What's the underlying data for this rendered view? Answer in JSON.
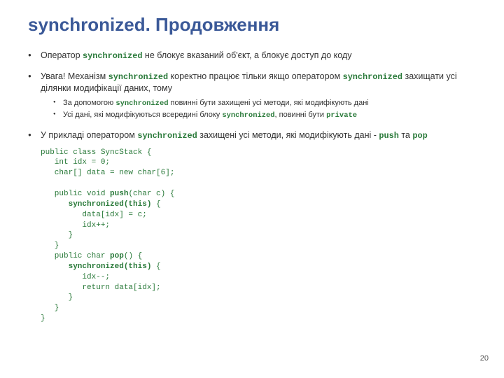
{
  "title": "synchronized. Продовження",
  "bullet1": {
    "pre": "Оператор ",
    "kw": "synchronized",
    "post": " не блокує вказаний об'єкт, а блокує доступ до коду"
  },
  "bullet2": {
    "pre": "Увага! Механізм ",
    "kw1": "synchronized",
    "mid": " коректно працює тільки якщо оператором ",
    "kw2": "synchronized",
    "post": " захищати усі ділянки модифікації даних, тому"
  },
  "bullet2_sub1": {
    "pre": "За допомогою ",
    "kw": "synchronized",
    "post": " повинні бути захищені усі методи, які модифікують дані"
  },
  "bullet2_sub2": {
    "pre": "Усі дані, які модифікуються всередині блоку ",
    "kw1": "synchronized",
    "mid": ", повинні бути ",
    "kw2": "private"
  },
  "bullet3": {
    "pre": "У прикладі оператором ",
    "kw1": "synchronized",
    "mid": " захищені усі методи, які модифікують дані - ",
    "kw2": "push",
    "mid2": " та ",
    "kw3": "pop"
  },
  "code": {
    "l1": "public class SyncStack {",
    "l2": "   int idx = 0;",
    "l3": "   char[] data = new char[6];",
    "l4": "",
    "l5a": "   public void ",
    "l5b": "push",
    "l5c": "(char c) {",
    "l6a": "      ",
    "l6b": "synchronized(this)",
    "l6c": " {",
    "l7": "         data[idx] = c;",
    "l8": "         idx++;",
    "l9": "      }",
    "l10": "   }",
    "l11a": "   public char ",
    "l11b": "pop",
    "l11c": "() {",
    "l12a": "      ",
    "l12b": "synchronized(this)",
    "l12c": " {",
    "l13": "         idx--;",
    "l14": "         return data[idx];",
    "l15": "      }",
    "l16": "   }",
    "l17": "}"
  },
  "page_number": "20"
}
